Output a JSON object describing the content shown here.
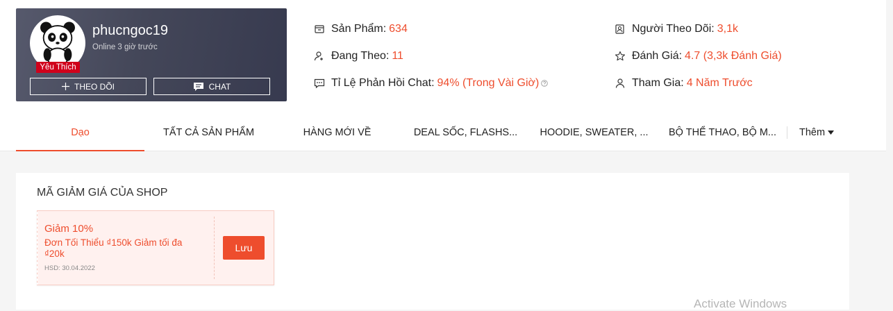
{
  "shop": {
    "name": "phucngoc19",
    "status": "Online 3 giờ trước",
    "badge": "Yêu Thích",
    "follow_label": "THEO DÕI",
    "chat_label": "CHAT"
  },
  "stats": {
    "products": {
      "label": "Sản Phẩm:",
      "value": "634",
      "icon": "store-icon"
    },
    "following": {
      "label": "Đang Theo:",
      "value": "11",
      "icon": "user-add-icon"
    },
    "chat_response": {
      "label": "Tỉ Lệ Phản Hồi Chat:",
      "value": "94% (Trong Vài Giờ)",
      "icon": "chat-bubble-icon"
    },
    "followers": {
      "label": "Người Theo Dõi:",
      "value": "3,1k",
      "icon": "followers-icon"
    },
    "rating": {
      "label": "Đánh Giá:",
      "value": "4.7 (3,3k Đánh Giá)",
      "icon": "star-icon"
    },
    "joined": {
      "label": "Tham Gia:",
      "value": "4 Năm Trước",
      "icon": "user-icon"
    }
  },
  "tabs": [
    {
      "label": "Dạo",
      "active": true
    },
    {
      "label": "TẤT CẢ SẢN PHẨM"
    },
    {
      "label": "HÀNG MỚI VỀ"
    },
    {
      "label": "DEAL SỐC, FLASHS..."
    },
    {
      "label": "HOODIE, SWEATER, ..."
    },
    {
      "label": "BỘ THỂ THAO, BỘ M..."
    }
  ],
  "more_label": "Thêm",
  "vouchers_section": {
    "title": "MÃ GIẢM GIÁ CỦA SHOP",
    "vouchers": [
      {
        "title": "Giảm 10%",
        "description": "Đơn Tối Thiểu ₫150k Giảm tối đa ₫20k",
        "expiry": "HSD: 30.04.2022",
        "button": "Lưu"
      }
    ]
  },
  "watermark": "Activate Windows",
  "colors": {
    "accent": "#ee4d2d",
    "card_bg": "#44475a",
    "badge": "#d0011b"
  }
}
